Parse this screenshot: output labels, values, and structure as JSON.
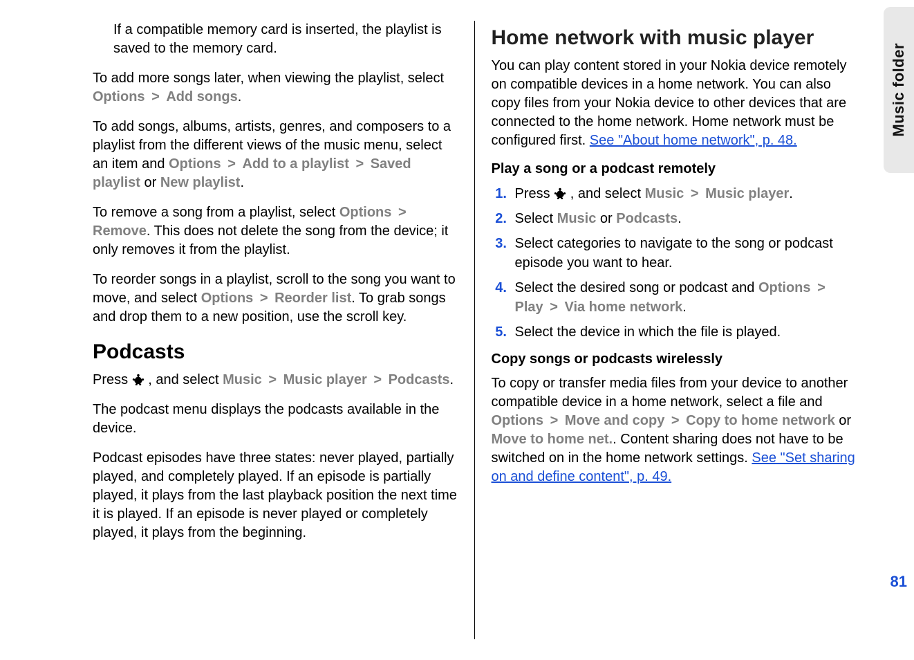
{
  "side_tab": "Music folder",
  "page_number": "81",
  "left": {
    "p1": "If a compatible memory card is inserted, the playlist is saved to the memory card.",
    "p2_a": "To add more songs later, when viewing the playlist, select ",
    "p2_options": "Options",
    "p2_gt": ">",
    "p2_addsongs": "Add songs",
    "p2_end": ".",
    "p3_a": "To add songs, albums, artists, genres, and composers to a playlist from the different views of the music menu, select an item and ",
    "p3_options": "Options",
    "p3_add": "Add to a playlist",
    "p3_saved": "Saved playlist",
    "p3_or": " or ",
    "p3_new": "New playlist",
    "p4_a": "To remove a song from a playlist, select ",
    "p4_options": "Options",
    "p4_remove": "Remove",
    "p4_b": ". This does not delete the song from the device; it only removes it from the playlist.",
    "p5_a": "To reorder songs in a playlist, scroll to the song you want to move, and select ",
    "p5_options": "Options",
    "p5_reorder": "Reorder list",
    "p5_b": ". To grab songs and drop them to a new position, use the scroll key.",
    "h_podcasts": "Podcasts",
    "p6_a": "Press ",
    "p6_b": ", and select ",
    "p6_music": "Music",
    "p6_musicplayer": "Music player",
    "p6_podcasts": "Podcasts",
    "p7": "The podcast menu displays the podcasts available in the device.",
    "p8": "Podcast episodes have three states: never played, partially played, and completely played. If an episode is partially played, it plays from the last playback position the next time it is played. If an episode is never played or completely played, it plays from the beginning."
  },
  "right": {
    "h1": "Home network with music player",
    "intro_a": "You can play content stored in your Nokia device remotely on compatible devices in a home network. You can also copy files from your Nokia device to other devices that are connected to the home network. Home network must be configured first. ",
    "intro_link": "See \"About home network\", p. 48.",
    "sub1": "Play a song or a podcast remotely",
    "li1_a": "Press ",
    "li1_b": ", and select ",
    "li1_music": "Music",
    "li1_musicplayer": "Music player",
    "li2_a": "Select ",
    "li2_music": "Music",
    "li2_or": " or ",
    "li2_podcasts": "Podcasts",
    "li3": "Select categories to navigate to the song or podcast episode you want to hear.",
    "li4_a": "Select the desired song or podcast and ",
    "li4_options": "Options",
    "li4_play": "Play",
    "li4_via": "Via home network",
    "li5": "Select the device in which the file is played.",
    "sub2": "Copy songs or podcasts wirelessly",
    "copy_a": "To copy or transfer media files from your device to another compatible device in a home network, select a file and ",
    "copy_options": "Options",
    "copy_move": "Move and copy",
    "copy_copyhome": "Copy to home network",
    "copy_or": " or ",
    "copy_movehome": "Move to home net.",
    "copy_b": ". Content sharing does not have to be switched on in the home network settings. ",
    "copy_link": "See \"Set sharing on and define content\", p. 49."
  }
}
